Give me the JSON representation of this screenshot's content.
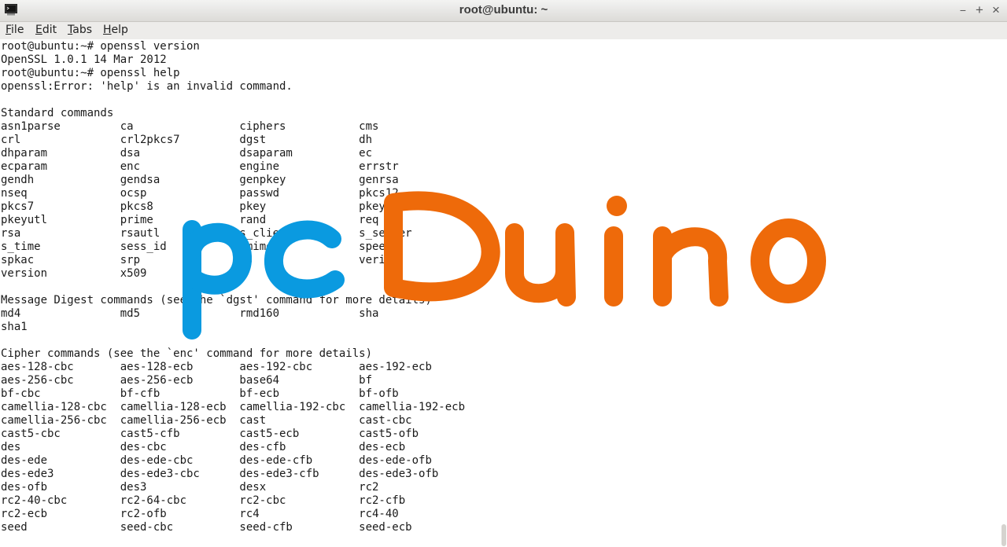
{
  "window": {
    "title": "root@ubuntu: ~",
    "buttons": {
      "minimize": "−",
      "maximize": "+",
      "close": "×"
    }
  },
  "menu": {
    "file": {
      "mnemonic": "F",
      "rest": "ile"
    },
    "edit": {
      "mnemonic": "E",
      "rest": "dit"
    },
    "tabs": {
      "mnemonic": "T",
      "rest": "abs"
    },
    "help": {
      "mnemonic": "H",
      "rest": "elp"
    }
  },
  "terminal": {
    "lines": [
      "root@ubuntu:~# openssl version",
      "OpenSSL 1.0.1 14 Mar 2012",
      "root@ubuntu:~# openssl help",
      "openssl:Error: 'help' is an invalid command.",
      "",
      "Standard commands",
      "asn1parse         ca                ciphers           cms",
      "crl               crl2pkcs7         dgst              dh",
      "dhparam           dsa               dsaparam          ec",
      "ecparam           enc               engine            errstr",
      "gendh             gendsa            genpkey           genrsa",
      "nseq              ocsp              passwd            pkcs12",
      "pkcs7             pkcs8             pkey              pkeyparam",
      "pkeyutl           prime             rand              req",
      "rsa               rsautl            s_client          s_server",
      "s_time            sess_id           smime             speed",
      "spkac             srp               ts                verify",
      "version           x509",
      "",
      "Message Digest commands (see the `dgst' command for more details)",
      "md4               md5               rmd160            sha",
      "sha1",
      "",
      "Cipher commands (see the `enc' command for more details)",
      "aes-128-cbc       aes-128-ecb       aes-192-cbc       aes-192-ecb",
      "aes-256-cbc       aes-256-ecb       base64            bf",
      "bf-cbc            bf-cfb            bf-ecb            bf-ofb",
      "camellia-128-cbc  camellia-128-ecb  camellia-192-cbc  camellia-192-ecb",
      "camellia-256-cbc  camellia-256-ecb  cast              cast-cbc",
      "cast5-cbc         cast5-cfb         cast5-ecb         cast5-ofb",
      "des               des-cbc           des-cfb           des-ecb",
      "des-ede           des-ede-cbc       des-ede-cfb       des-ede-ofb",
      "des-ede3          des-ede3-cbc      des-ede3-cfb      des-ede3-ofb",
      "des-ofb           des3              desx              rc2",
      "rc2-40-cbc        rc2-64-cbc        rc2-cbc           rc2-cfb",
      "rc2-ecb           rc2-ofb           rc4               rc4-40",
      "seed              seed-cbc          seed-cfb          seed-ecb"
    ]
  },
  "watermark": {
    "text": "pcDuino",
    "color_pc": "#0a9ae0",
    "color_duino": "#ee6a0a"
  },
  "icons": {
    "app": "terminal-icon"
  }
}
